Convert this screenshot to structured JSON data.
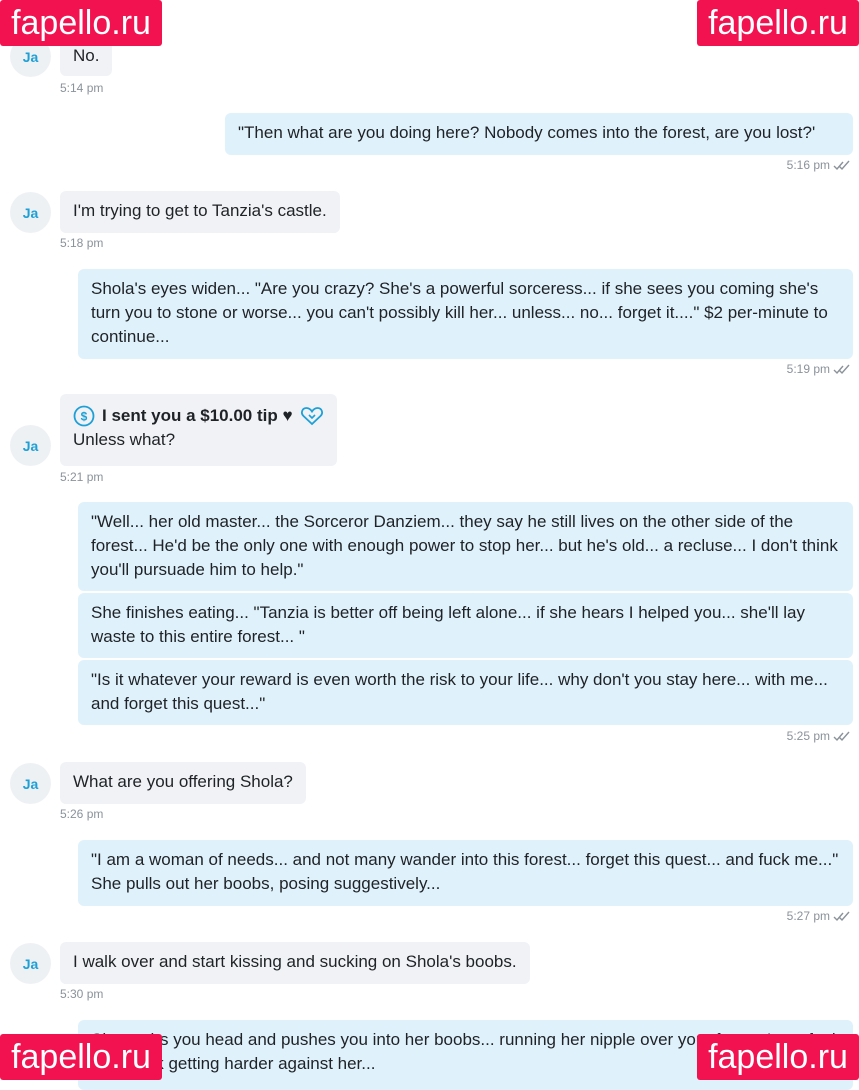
{
  "watermark": "fapello.ru",
  "avatar_initials": "Ja",
  "messages": [
    {
      "text": "No.",
      "time": "5:14 pm"
    },
    {
      "text": "\"Then what are you doing here? Nobody comes into the forest, are you lost?'",
      "time": "5:16 pm"
    },
    {
      "text": "I'm trying to get to Tanzia's castle.",
      "time": "5:18 pm"
    },
    {
      "text": "Shola's eyes widen... \"Are you crazy? She's a powerful sorceress... if she sees you coming she's turn you to stone or worse... you can't possibly kill her... unless... no... forget it....\" $2 per-minute to continue...",
      "time": "5:19 pm"
    },
    {
      "tip": "I sent you a $10.00 tip ♥",
      "text": "Unless what?",
      "time": "5:21 pm"
    },
    {
      "text": "\"Well... her old master... the Sorceror Danziem... they say he still lives on the other side of the forest... He'd be the only one with enough power to stop her... but he's old... a recluse... I don't think you'll pursuade him to help.\""
    },
    {
      "text": "She finishes eating... \"Tanzia is better off being left alone... if she hears I helped you... she'll lay waste to this entire forest... \""
    },
    {
      "text": "\"Is it whatever your reward is even worth the risk to your life... why don't you stay here... with me... and forget this quest...\"",
      "time": "5:25 pm"
    },
    {
      "text": "What are you offering Shola?",
      "time": "5:26 pm"
    },
    {
      "text": "\"I am a woman of needs... and not many wander into this forest... forget this quest... and fuck me...\" She pulls out her boobs, posing suggestively...",
      "time": "5:27 pm"
    },
    {
      "text": "I walk over and start kissing and sucking on Shola's boobs.",
      "time": "5:30 pm"
    },
    {
      "text": "She grabs you head and pushes you into her boobs... running her nipple over your face... I can feel your cock getting harder against her..."
    }
  ]
}
